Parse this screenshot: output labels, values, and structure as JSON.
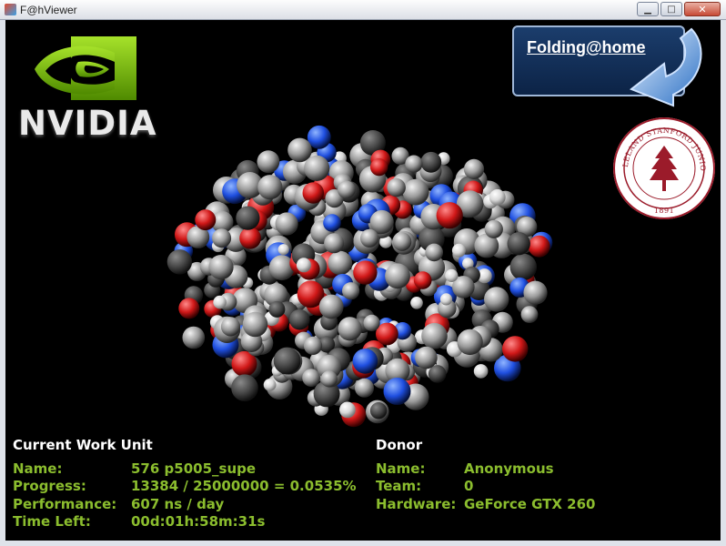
{
  "window": {
    "title": "F@hViewer",
    "buttons": {
      "minimize": "▁",
      "maximize": "□",
      "close": "✕"
    }
  },
  "branding": {
    "nvidia_text": "NVIDIA",
    "folding_label": "Folding@home",
    "seal": {
      "top_text": "LELAND STANFORD JUNIOR UNIVERSITY",
      "year": "1891"
    }
  },
  "colors": {
    "accent_green": "#8bbd2e",
    "nvidia_green": "#76b900",
    "fah_blue": "#1b3d6c",
    "stanford_red": "#9b1b2a"
  },
  "work_unit": {
    "heading": "Current Work Unit",
    "rows": [
      {
        "label": "Name:",
        "value": "576 p5005_supe"
      },
      {
        "label": "Progress:",
        "value": "13384 / 25000000 = 0.0535%"
      },
      {
        "label": "Performance:",
        "value": "607 ns / day"
      },
      {
        "label": "Time Left:",
        "value": "00d:01h:58m:31s"
      }
    ]
  },
  "donor": {
    "heading": "Donor",
    "rows": [
      {
        "label": "Name:",
        "value": "Anonymous"
      },
      {
        "label": "Team:",
        "value": "0"
      },
      {
        "label": "Hardware:",
        "value": "GeForce GTX 260"
      }
    ]
  }
}
